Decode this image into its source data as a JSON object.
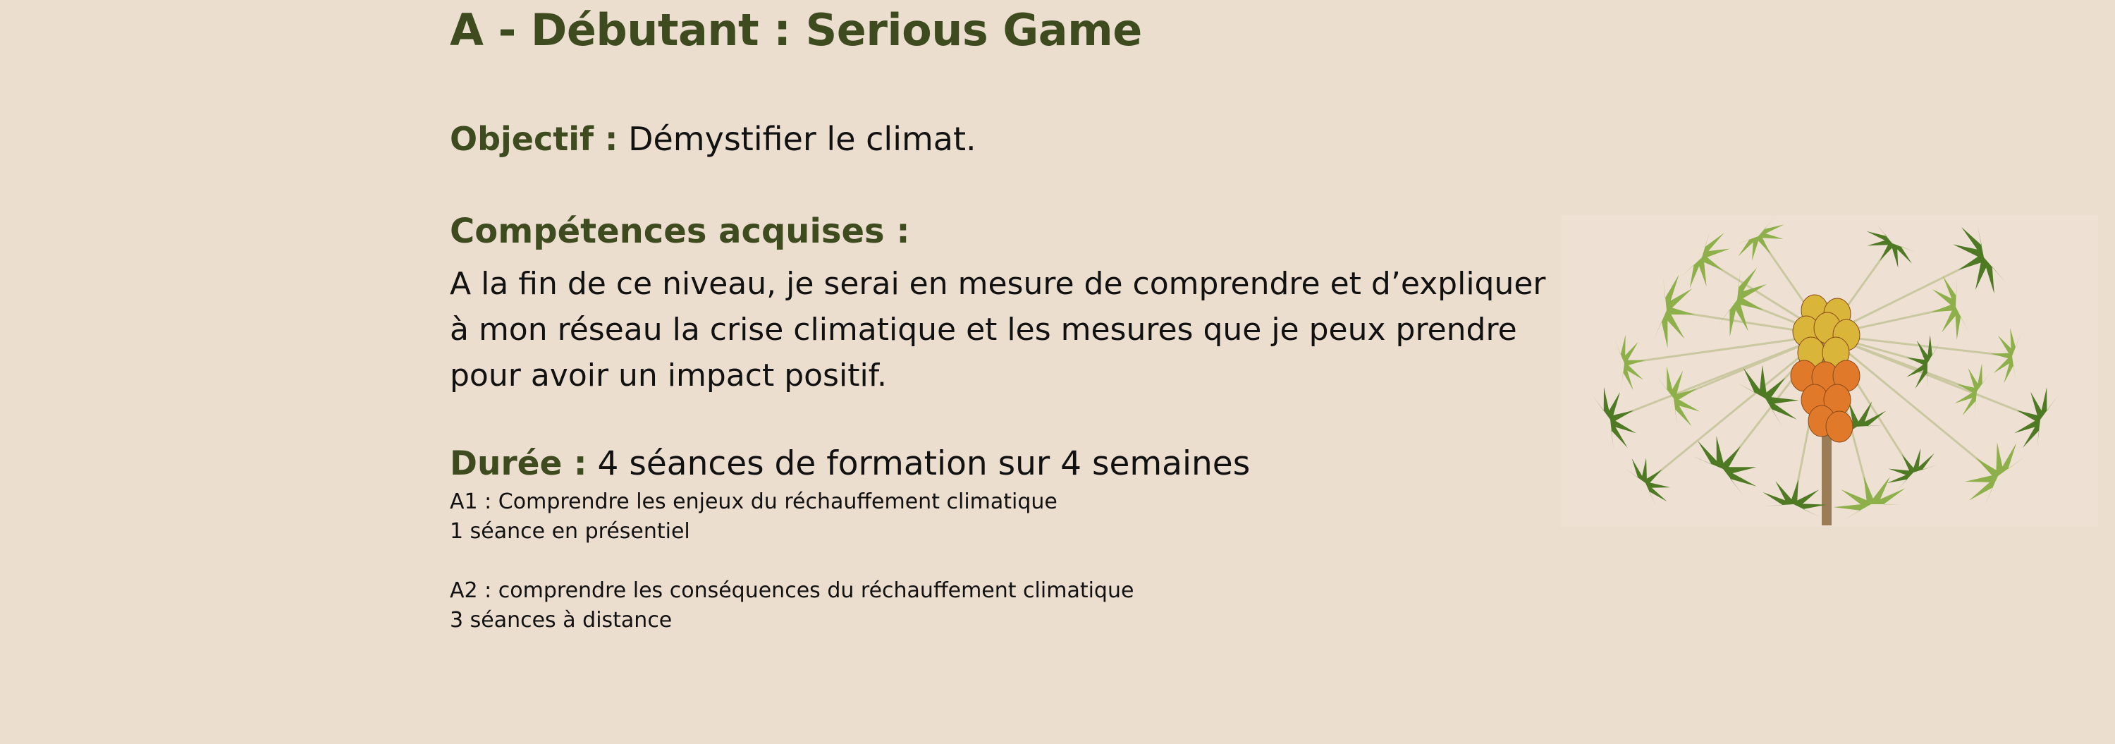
{
  "title": "A - Débutant : Serious Game",
  "objectif": {
    "label": "Objectif :",
    "text": "Démystifier le climat."
  },
  "competences": {
    "label": "Compétences acquises :",
    "text": "A la fin de ce niveau, je serai en mesure de comprendre et d’expliquer à mon réseau la crise climatique et les mesures que je peux prendre pour avoir un impact positif."
  },
  "duree": {
    "label": "Durée :",
    "text": "4 séances de formation sur 4 semaines"
  },
  "modules": [
    {
      "title": "A1 : Comprendre les enjeux du réchauffement climatique",
      "sessions": "1 séance en présentiel"
    },
    {
      "title": "A2 : comprendre les conséquences du réchauffement climatique",
      "sessions": "3 séances à distance"
    }
  ],
  "illustration": {
    "subject": "papaya-tree-illustration",
    "colors": {
      "leaf": "#4f7a24",
      "leaf_light": "#8db04a",
      "fruit_orange": "#e07a2a",
      "fruit_yellow": "#d9b53a",
      "trunk": "#9a7c56"
    }
  },
  "colors": {
    "background": "#ecdecf",
    "heading": "#3d4b1f",
    "text": "#111111"
  }
}
